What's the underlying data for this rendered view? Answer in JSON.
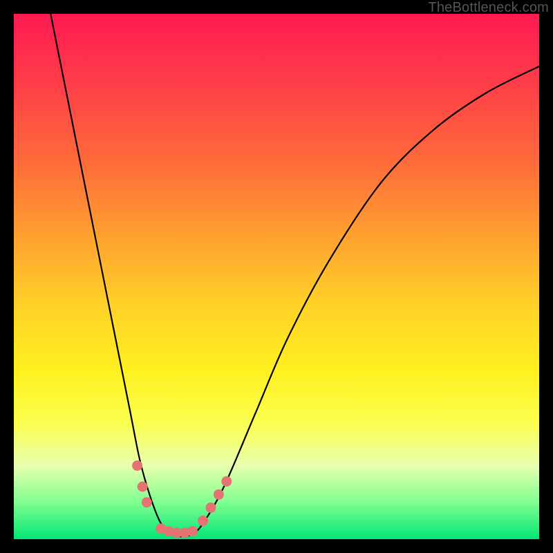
{
  "watermark": "TheBottleneck.com",
  "chart_data": {
    "type": "line",
    "title": "",
    "xlabel": "",
    "ylabel": "",
    "xlim": [
      0,
      100
    ],
    "ylim": [
      0,
      100
    ],
    "series": [
      {
        "name": "curve",
        "x": [
          7,
          10,
          14,
          18,
          22,
          24,
          26,
          28,
          30,
          32,
          34,
          36,
          40,
          46,
          52,
          60,
          70,
          80,
          90,
          100
        ],
        "y": [
          100,
          85,
          65,
          45,
          25,
          15,
          8,
          3,
          1,
          0.5,
          1,
          3,
          10,
          24,
          38,
          53,
          68,
          78,
          85,
          90
        ]
      }
    ],
    "markers": [
      {
        "x": 23.5,
        "y": 14
      },
      {
        "x": 24.5,
        "y": 10
      },
      {
        "x": 25.3,
        "y": 7
      },
      {
        "x": 28.0,
        "y": 2
      },
      {
        "x": 29.5,
        "y": 1.5
      },
      {
        "x": 31.0,
        "y": 1.2
      },
      {
        "x": 32.5,
        "y": 1.2
      },
      {
        "x": 34.0,
        "y": 1.5
      },
      {
        "x": 36.0,
        "y": 3.5
      },
      {
        "x": 37.5,
        "y": 6
      },
      {
        "x": 39.0,
        "y": 8.5
      },
      {
        "x": 40.5,
        "y": 11
      }
    ],
    "marker_color": "#e57373"
  }
}
